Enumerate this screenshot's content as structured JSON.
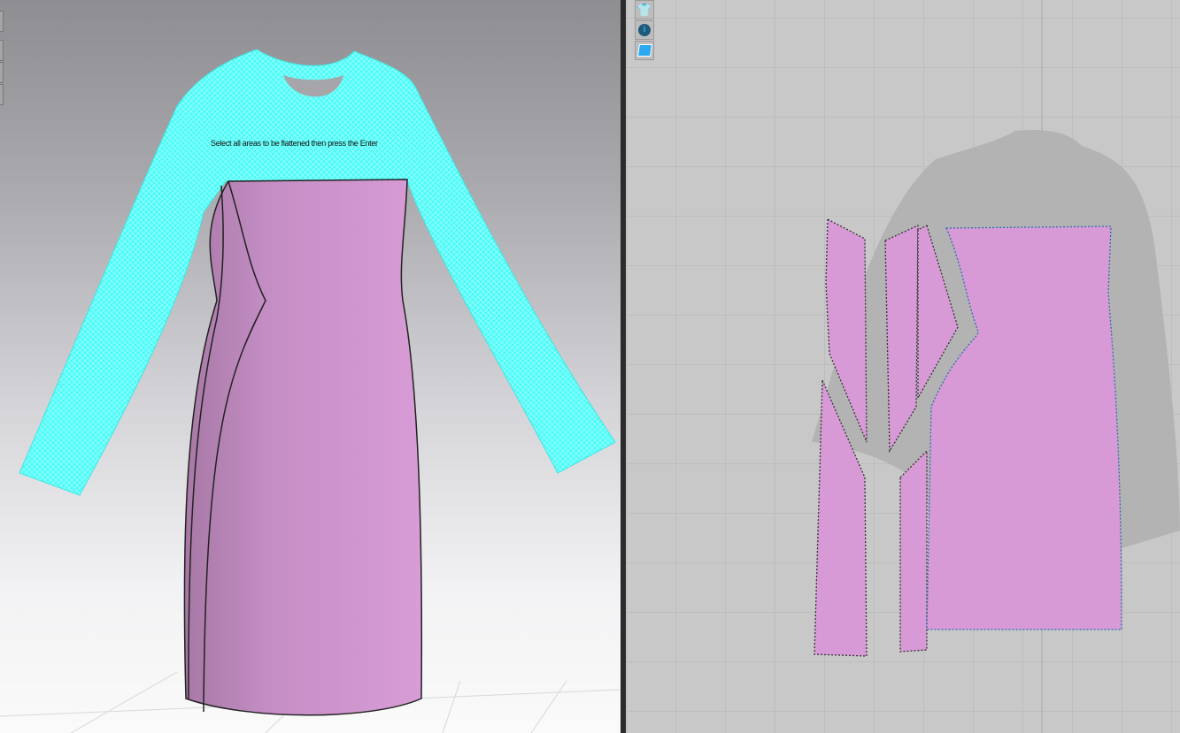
{
  "viewport3d": {
    "instruction": "Select all areas to be flattened then press the Enter"
  },
  "viewport2d": {
    "tools": [
      {
        "icon": "show-avatar-icon"
      },
      {
        "icon": "show-info-icon"
      },
      {
        "icon": "pattern-view-icon"
      }
    ]
  },
  "colors": {
    "fabric_pink": "#d79ad6",
    "mesh_cyan": "#4dfcf8",
    "panel_bg": "#c8c8c8",
    "divider": "#2c2c2e"
  }
}
